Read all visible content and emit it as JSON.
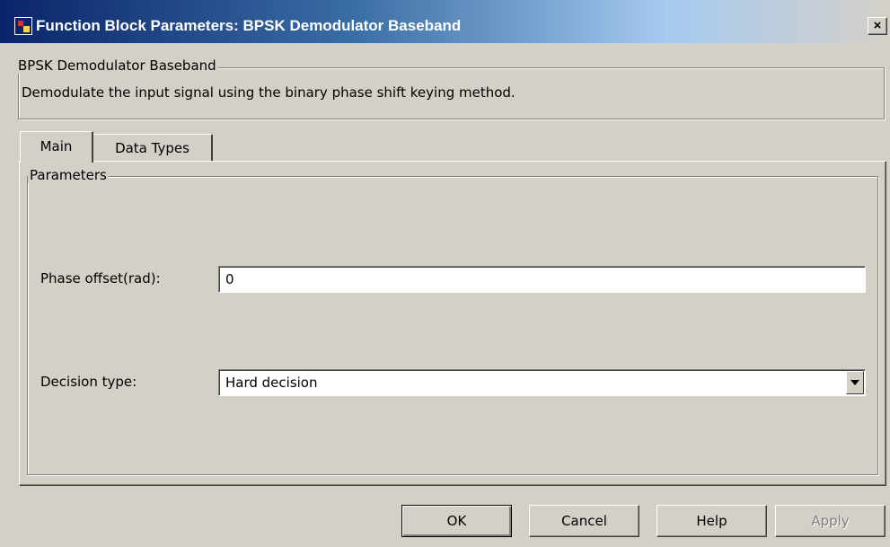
{
  "window": {
    "title": "Function Block Parameters: BPSK Demodulator Baseband",
    "close_glyph": "×",
    "icon": "simulink-block-icon"
  },
  "block_group": {
    "title": "BPSK Demodulator Baseband",
    "description": "Demodulate the input signal using the binary phase shift keying method."
  },
  "tabs": [
    {
      "label": "Main",
      "active": true
    },
    {
      "label": "Data Types",
      "active": false
    }
  ],
  "parameters": {
    "group_title": "Parameters",
    "phase_offset": {
      "label": "Phase offset(rad):",
      "value": "0"
    },
    "decision_type": {
      "label": "Decision type:",
      "value": "Hard decision"
    }
  },
  "buttons": {
    "ok": "OK",
    "cancel": "Cancel",
    "help": "Help",
    "apply": "Apply"
  },
  "colors": {
    "title_gradient_start": "#0a246a",
    "title_gradient_end": "#a6caf0",
    "face": "#d4d0c8"
  }
}
